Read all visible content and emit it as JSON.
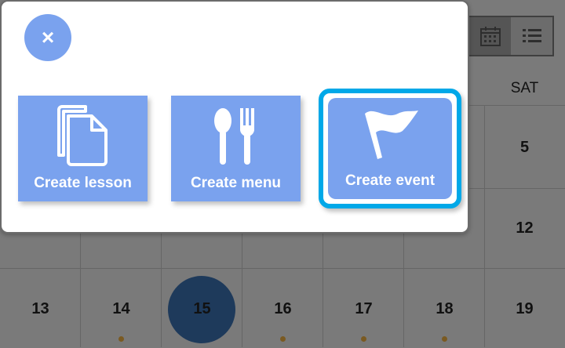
{
  "calendar": {
    "day_headers": [
      {
        "label": "SAT",
        "col": 6
      }
    ],
    "dates": [
      {
        "num": "5",
        "col": 6,
        "row": 0,
        "dot": false,
        "today": false
      },
      {
        "num": "12",
        "col": 6,
        "row": 1,
        "dot": false,
        "today": false
      },
      {
        "num": "13",
        "col": 0,
        "row": 2,
        "dot": false,
        "today": false
      },
      {
        "num": "14",
        "col": 1,
        "row": 2,
        "dot": true,
        "today": false
      },
      {
        "num": "15",
        "col": 2,
        "row": 2,
        "dot": false,
        "today": true
      },
      {
        "num": "16",
        "col": 3,
        "row": 2,
        "dot": true,
        "today": false
      },
      {
        "num": "17",
        "col": 4,
        "row": 2,
        "dot": true,
        "today": false
      },
      {
        "num": "18",
        "col": 5,
        "row": 2,
        "dot": true,
        "today": false
      },
      {
        "num": "19",
        "col": 6,
        "row": 2,
        "dot": false,
        "today": false
      }
    ],
    "view_toggle": [
      "calendar-view",
      "list-view"
    ]
  },
  "dialog": {
    "close_label": "×",
    "tiles": [
      {
        "label": "Create lesson",
        "icon": "document-icon"
      },
      {
        "label": "Create menu",
        "icon": "cutlery-icon"
      },
      {
        "label": "Create event",
        "icon": "flag-icon",
        "selected": true
      }
    ]
  },
  "colors": {
    "tile": "#7aa2ee",
    "selection": "#00a8e8",
    "today": "#1e3a5b",
    "event_dot": "#7a5a22"
  }
}
